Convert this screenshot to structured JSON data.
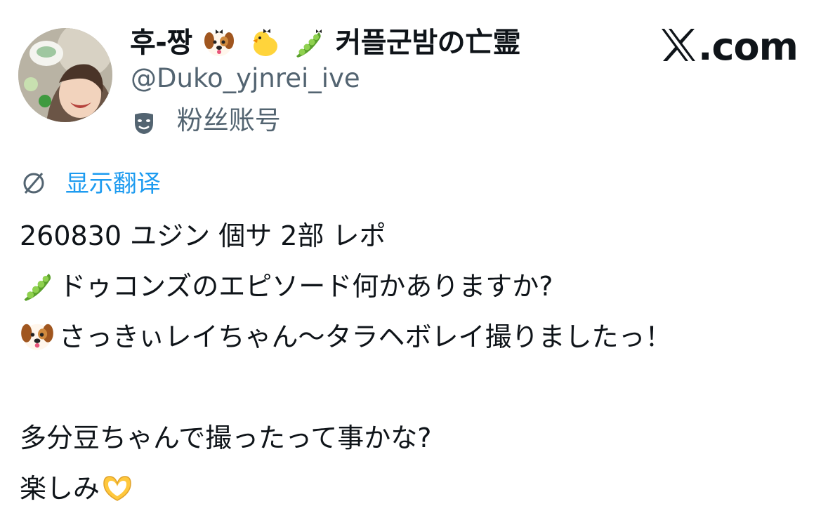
{
  "author": {
    "display_name_parts": [
      "후-짱",
      "커플군밤の亡霊"
    ],
    "handle": "@Duko_yjnrei_ive",
    "fan_label": "粉丝账号",
    "avatar_icon": "profile-photo"
  },
  "brand": {
    "text": ".com",
    "logo_icon": "x-logo-icon"
  },
  "translate": {
    "label": "显示翻译",
    "icon": "globe-slash-icon",
    "color": "#1d9bf0"
  },
  "tweet": {
    "lines": [
      "260830 ユジン 個サ 2部 レポ",
      "ドゥコンズのエピソード何かありますか?",
      "さっきぃレイちゃん～タラヘボレイ撮りましたっ！",
      "",
      "多分豆ちゃんで撮ったって事かな?",
      "楽しみ"
    ],
    "emoji": [
      "pea-pod-emoji",
      "dog-face-emoji",
      "heart-hands-emoji"
    ]
  },
  "colors": {
    "text": "#0f1419",
    "secondary": "#536471",
    "accent": "#1d9bf0"
  }
}
